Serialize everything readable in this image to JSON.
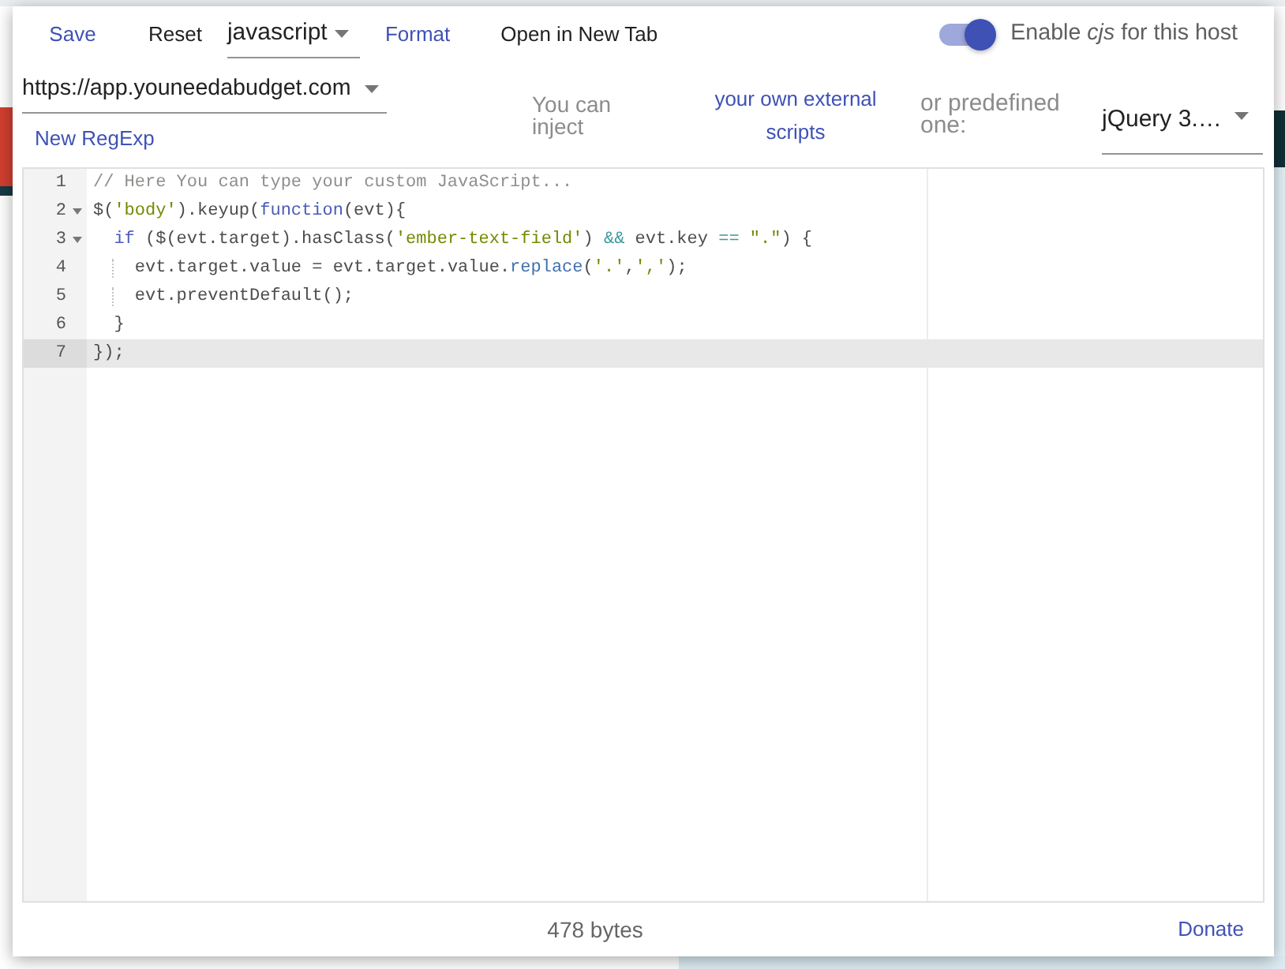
{
  "toolbar": [
    {
      "kind": "button",
      "label": "Save",
      "accent": true
    },
    {
      "kind": "button",
      "label": "Reset",
      "accent": false
    },
    {
      "kind": "dropdown",
      "value": "javascript"
    },
    {
      "kind": "button",
      "label": "Format",
      "accent": true
    },
    {
      "kind": "button",
      "label": "Open in New Tab",
      "accent": false
    }
  ],
  "host_toggle": {
    "on": true,
    "label": "Enable *cjs* for this host"
  },
  "url_dropdown": {
    "value": "https://app.youneedabudget.com"
  },
  "new_regexp_button": "New RegExp",
  "injection": {
    "intro": "You can inject",
    "link": "your own external scripts",
    "alternative": "or predefined one:",
    "library_dropdown": {
      "value": "jQuery 3.…"
    }
  },
  "editor": {
    "lines": [
      {
        "number": "1",
        "foldable": false,
        "active": false,
        "tokens": [
          {
            "kind": "comment",
            "text": "// Here You can type your custom JavaScript..."
          }
        ]
      },
      {
        "number": "2",
        "foldable": true,
        "active": false,
        "tokens": [
          {
            "kind": "plain",
            "text": "$("
          },
          {
            "kind": "string",
            "text": "'body'"
          },
          {
            "kind": "plain",
            "text": ").keyup("
          },
          {
            "kind": "keyword",
            "text": "function"
          },
          {
            "kind": "plain",
            "text": "(evt){"
          }
        ]
      },
      {
        "number": "3",
        "foldable": true,
        "active": false,
        "tokens": [
          {
            "kind": "keyword",
            "text": "  if"
          },
          {
            "kind": "plain",
            "text": " ($(evt.target).hasClass("
          },
          {
            "kind": "string",
            "text": "'ember-text-field'"
          },
          {
            "kind": "plain",
            "text": ") "
          },
          {
            "kind": "operator",
            "text": "&&"
          },
          {
            "kind": "plain",
            "text": " evt.key "
          },
          {
            "kind": "operator",
            "text": "== "
          },
          {
            "kind": "string",
            "text": "\".\""
          },
          {
            "kind": "plain",
            "text": ") {"
          }
        ]
      },
      {
        "number": "4",
        "foldable": false,
        "active": false,
        "tokens": [
          {
            "kind": "plain",
            "text": "    evt.target.value = evt.target.value."
          },
          {
            "kind": "function",
            "text": "replace"
          },
          {
            "kind": "plain",
            "text": "("
          },
          {
            "kind": "string",
            "text": "'.'"
          },
          {
            "kind": "plain",
            "text": ","
          },
          {
            "kind": "string",
            "text": "','"
          },
          {
            "kind": "plain",
            "text": ");"
          }
        ]
      },
      {
        "number": "5",
        "foldable": false,
        "active": false,
        "tokens": [
          {
            "kind": "plain",
            "text": "    evt.preventDefault();"
          }
        ]
      },
      {
        "number": "6",
        "foldable": false,
        "active": false,
        "tokens": [
          {
            "kind": "plain",
            "text": "  }"
          }
        ]
      },
      {
        "number": "7",
        "foldable": false,
        "active": true,
        "tokens": [
          {
            "kind": "plain",
            "text": "});"
          }
        ]
      }
    ]
  },
  "footer": {
    "size": "478 bytes",
    "donate": "Donate"
  }
}
